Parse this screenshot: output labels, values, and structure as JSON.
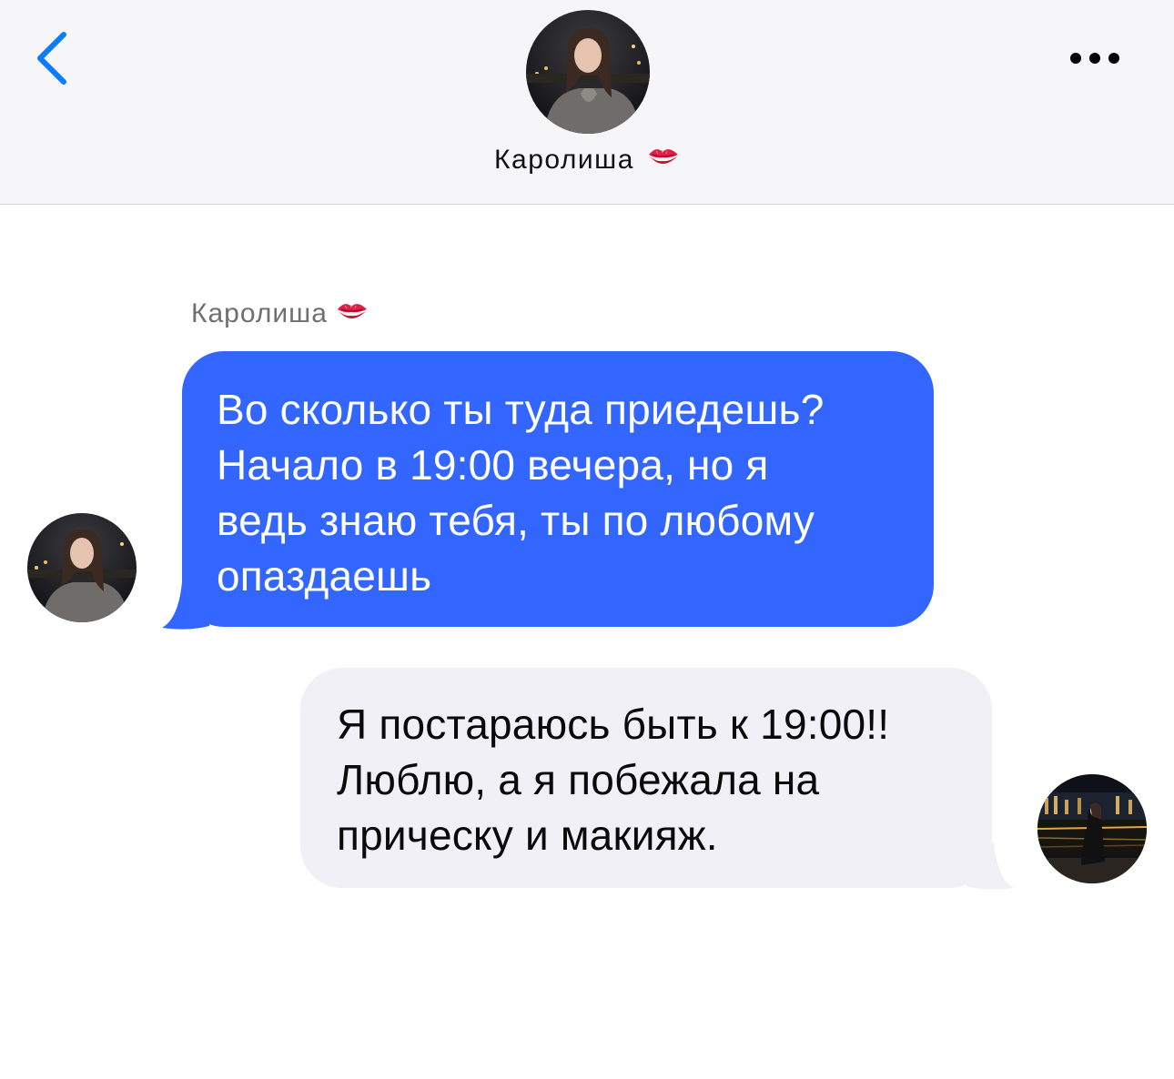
{
  "header": {
    "contact_name": "Каролиша",
    "contact_emoji": "💋",
    "back_icon": "chevron-left-icon",
    "more_icon": "ellipsis-icon",
    "accent_color": "#0a7aff"
  },
  "messages": [
    {
      "direction": "incoming",
      "sender": "Каролиша",
      "sender_emoji": "💋",
      "lines": [
        "Во сколько ты туда приедешь?",
        "Начало в 19:00 вечера, но я",
        "ведь знаю тебя, ты по любому",
        "опаздаешь"
      ],
      "bubble_color": "#3366ff",
      "text_color": "#ffffff"
    },
    {
      "direction": "outgoing",
      "lines": [
        "Я постараюсь быть к 19:00!!",
        "Люблю, а я побежала на",
        "прическу и макияж."
      ],
      "bubble_color": "#f1f0f6",
      "text_color": "#0a0a0a"
    }
  ]
}
